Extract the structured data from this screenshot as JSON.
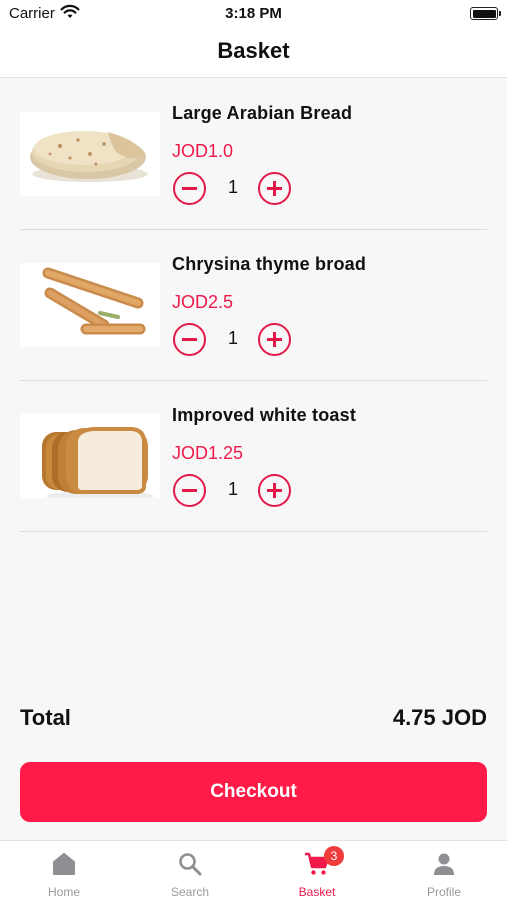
{
  "status_bar": {
    "carrier": "Carrier",
    "time": "3:18 PM"
  },
  "nav": {
    "title": "Basket"
  },
  "items": [
    {
      "name": "Large Arabian Bread",
      "price": "JOD1.0",
      "qty": "1",
      "image_icon": "arabian-bread-image"
    },
    {
      "name": "Chrysina thyme broad",
      "price": "JOD2.5",
      "qty": "1",
      "image_icon": "thyme-sticks-image"
    },
    {
      "name": "Improved white toast",
      "price": "JOD1.25",
      "qty": "1",
      "image_icon": "white-toast-image"
    }
  ],
  "summary": {
    "total_label": "Total",
    "total_value": "4.75 JOD"
  },
  "checkout": {
    "label": "Checkout"
  },
  "tabs": [
    {
      "label": "Home",
      "icon": "home-icon"
    },
    {
      "label": "Search",
      "icon": "search-icon"
    },
    {
      "label": "Basket",
      "icon": "cart-icon",
      "badge": "3",
      "active": true
    },
    {
      "label": "Profile",
      "icon": "profile-icon"
    }
  ],
  "colors": {
    "accent": "#ff1a47",
    "price": "#f0194a",
    "badge": "#ef3b3b",
    "inactive": "#9a9a9a"
  }
}
